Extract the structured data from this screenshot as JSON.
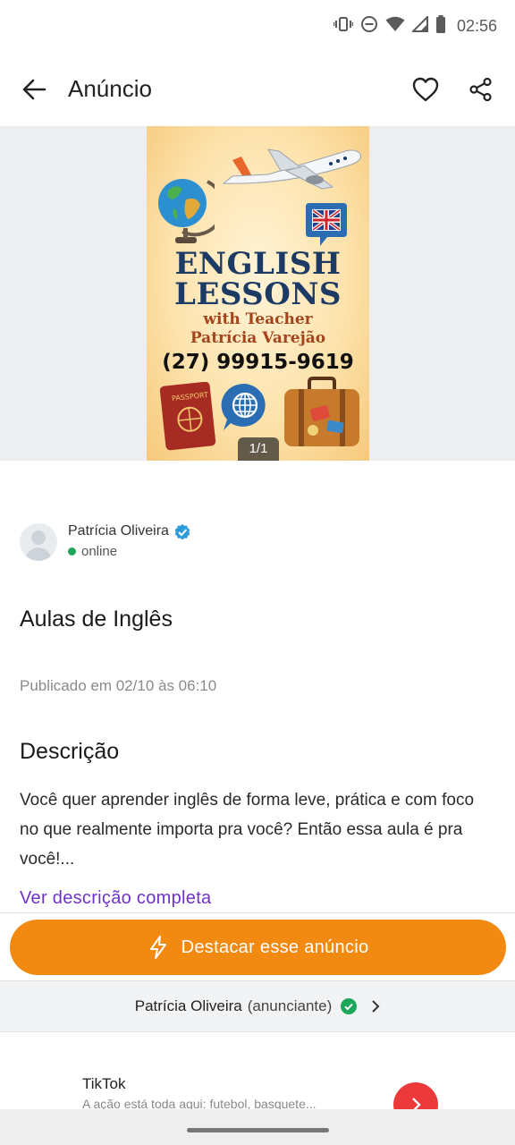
{
  "status_bar": {
    "time": "02:56",
    "icons": [
      "vibrate-icon",
      "dnd-icon",
      "wifi-icon",
      "signal-icon",
      "battery-icon"
    ]
  },
  "app_bar": {
    "title": "Anúncio",
    "icons": [
      "back-arrow-icon",
      "heart-icon",
      "share-icon"
    ]
  },
  "gallery": {
    "poster": {
      "line1": "ENGLISH",
      "line2": "LESSONS",
      "line3": "with Teacher",
      "line4": "Patrícia Varejão",
      "phone": "(27) 99915-9619",
      "passport_text": "PASSPORT"
    },
    "counter": "1/1"
  },
  "seller": {
    "name": "Patrícia Oliveira",
    "status": "online",
    "verified_color": "#2d9cdb",
    "online_color": "#1ea65b"
  },
  "listing": {
    "title": "Aulas de Inglês",
    "published": "Publicado em 02/10 às 06:10",
    "description_heading": "Descrição",
    "description": "Você quer aprender inglês de forma leve, prática e com foco no que realmente importa pra você? Então essa aula é pra você!...",
    "see_full_description": "Ver descrição completa"
  },
  "actions": {
    "highlight_label": "Destacar esse anúncio",
    "highlight_color": "#f28a11"
  },
  "advertiser_bar": {
    "name": "Patrícia Oliveira",
    "role": "(anunciante)"
  },
  "sponsored": {
    "name": "TikTok",
    "text": "A ação está toda aqui: futebol, basquete..."
  },
  "colors": {
    "link": "#6e32c9",
    "accent": "#f28a11"
  }
}
